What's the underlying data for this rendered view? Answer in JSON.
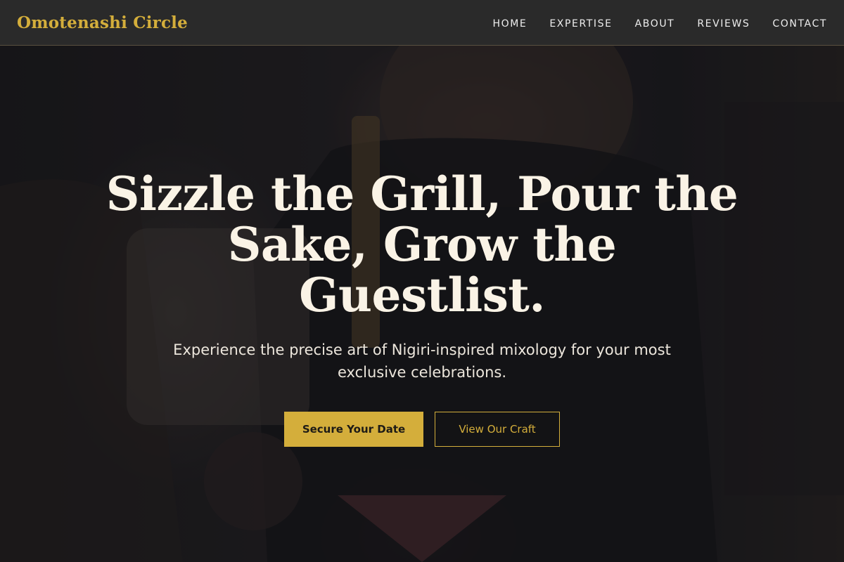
{
  "brand": {
    "name": "Omotenashi Circle"
  },
  "nav": {
    "items": [
      {
        "label": "HOME"
      },
      {
        "label": "EXPERTISE"
      },
      {
        "label": "ABOUT"
      },
      {
        "label": "REVIEWS"
      },
      {
        "label": "CONTACT"
      }
    ]
  },
  "hero": {
    "title": "Sizzle the Grill, Pour the Sake, Grow the Guestlist.",
    "subtitle": "Experience the precise art of Nigiri-inspired mixology for your most exclusive celebrations.",
    "primary_button": "Secure Your Date",
    "secondary_button": "View Our Craft",
    "background_image": "bartender-pouring-cocktail-photo"
  },
  "colors": {
    "accent": "#d4ae3b",
    "nav_background": "#2a2a2a",
    "hero_text": "#faf3e6"
  }
}
